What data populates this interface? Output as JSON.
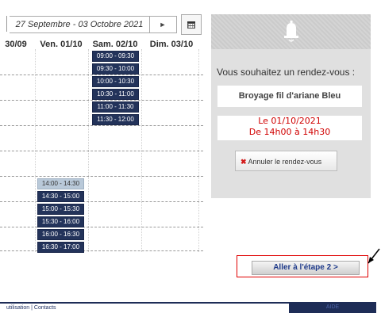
{
  "nav": {
    "range": "27 Septembre - 03 Octobre 2021",
    "next_symbol": "►"
  },
  "days": {
    "col0": "30/09",
    "col1": "Ven. 01/10",
    "col2": "Sam. 02/10",
    "col3": "Dim. 03/10"
  },
  "slots": {
    "sat": [
      "09:00 - 09:30",
      "09:30 - 10:00",
      "10:00 - 10:30",
      "10:30 - 11:00",
      "11:00 - 11:30",
      "11:30 - 12:00"
    ],
    "fri": [
      "14:00 - 14:30",
      "14:30 - 15:00",
      "15:00 - 15:30",
      "15:30 - 16:00",
      "16:00 - 16:30",
      "16:30 - 17:00"
    ],
    "selected": "14:00 - 14:30"
  },
  "panel": {
    "question": "Vous souhaitez un rendez-vous :",
    "service": "Broyage fil d'ariane Bleu",
    "date_line": "Le 01/10/2021",
    "time_line": "De 14h00 à 14h30",
    "cancel_label": "Annuler le rendez-vous",
    "cancel_icon": "✖"
  },
  "next_step": {
    "label": "Aller à l'étape 2 >"
  },
  "footer": {
    "links": "utilisation | Contacts",
    "aide": "AIDE"
  },
  "colors": {
    "slot_bg": "#23335a",
    "selected_slot_bg": "#b9c9d9",
    "panel_bg": "#e0e0e0",
    "date_text": "#d00000",
    "highlight_border": "#e00000",
    "footer_bar": "#1e2d57"
  }
}
